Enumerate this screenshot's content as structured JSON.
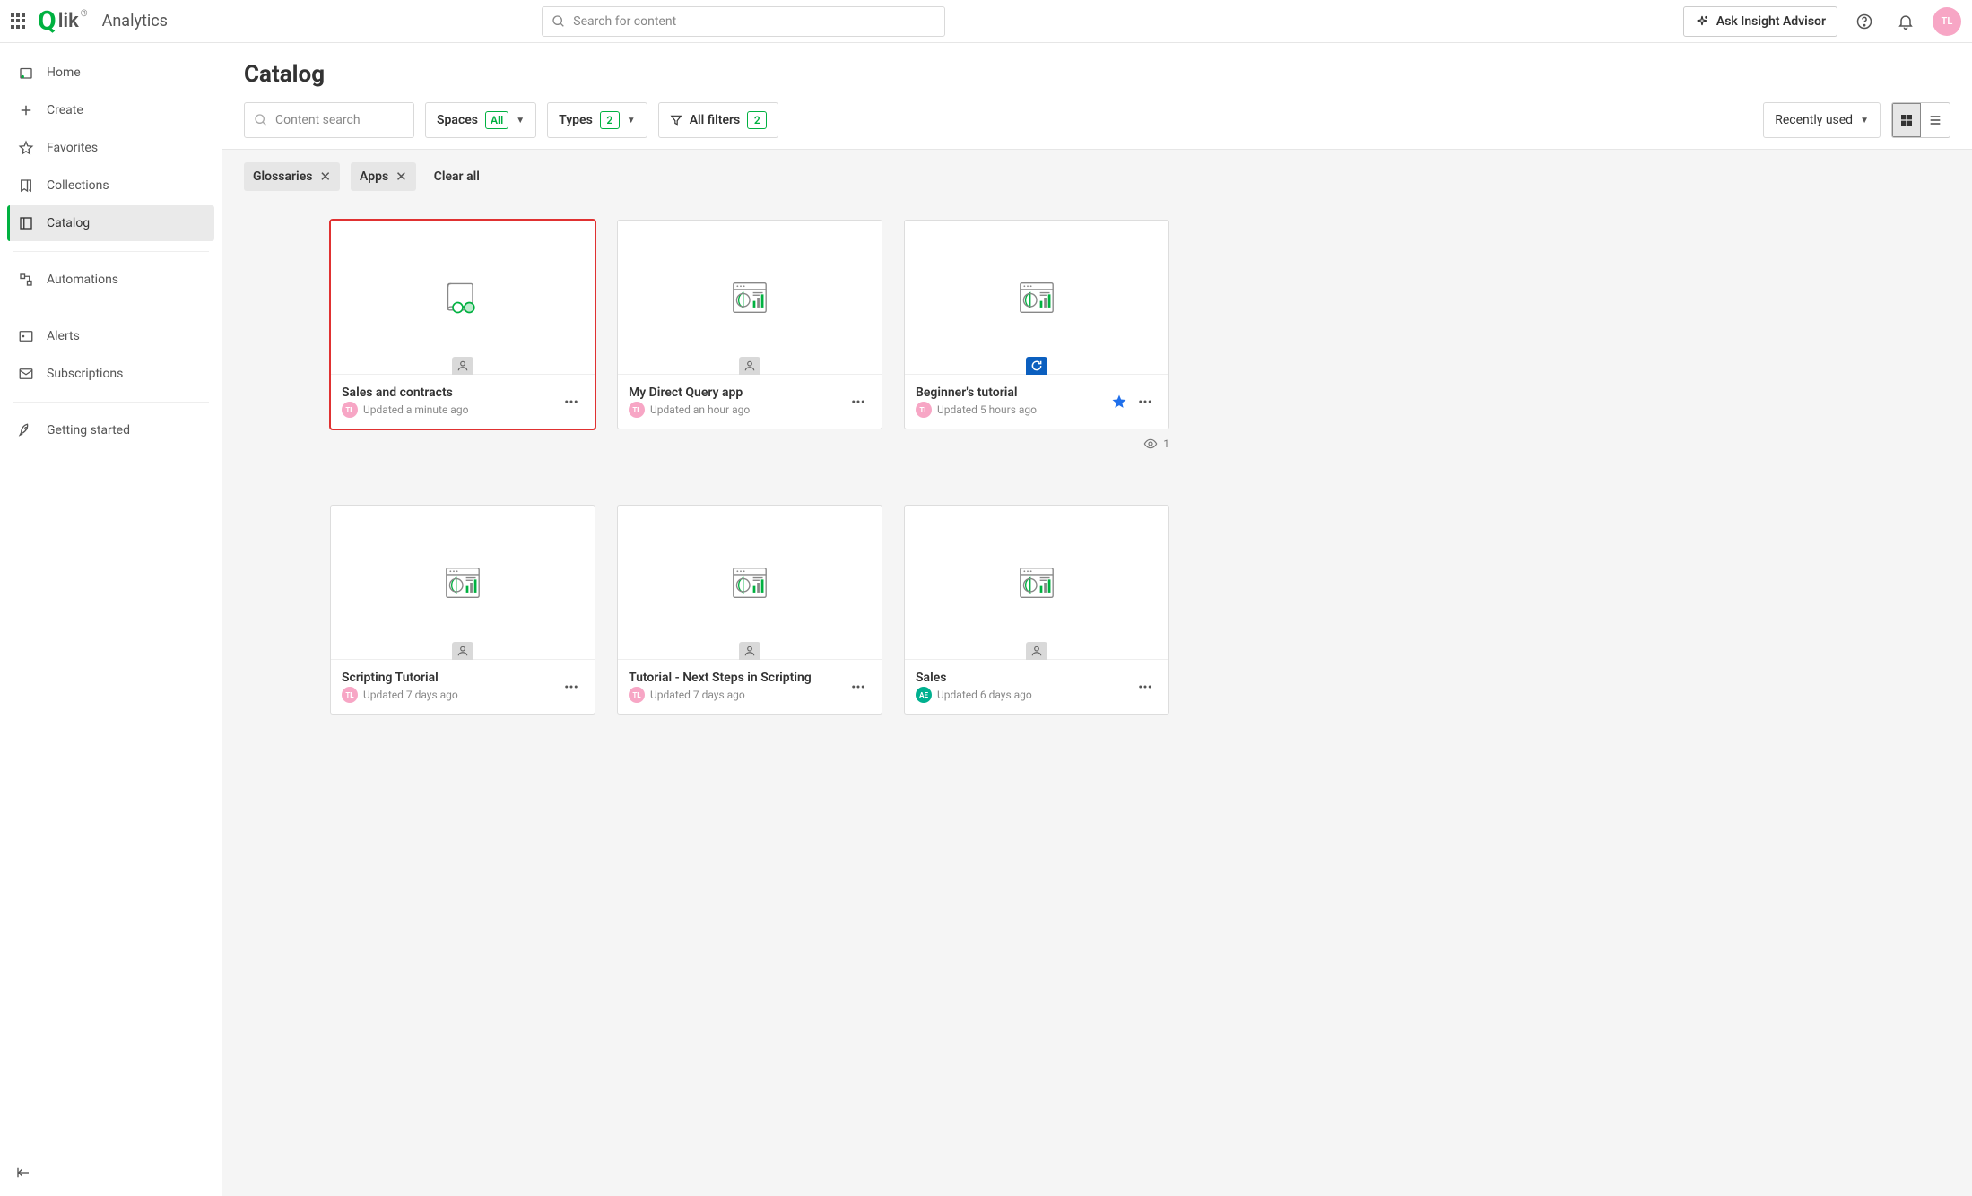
{
  "brand": {
    "logo_text": "lik",
    "section": "Analytics"
  },
  "topbar": {
    "search_placeholder": "Search for content",
    "ask_label": "Ask Insight Advisor",
    "avatar_initials": "TL"
  },
  "sidebar": {
    "home": "Home",
    "create": "Create",
    "favorites": "Favorites",
    "collections": "Collections",
    "catalog": "Catalog",
    "automations": "Automations",
    "alerts": "Alerts",
    "subscriptions": "Subscriptions",
    "getting_started": "Getting started"
  },
  "page": {
    "title": "Catalog"
  },
  "toolbar": {
    "content_search_placeholder": "Content search",
    "spaces_label": "Spaces",
    "spaces_badge": "All",
    "types_label": "Types",
    "types_badge": "2",
    "allfilters_label": "All filters",
    "allfilters_badge": "2",
    "sort_label": "Recently used"
  },
  "chips": {
    "glossaries": "Glossaries",
    "apps": "Apps",
    "clear_all": "Clear all"
  },
  "cards": [
    {
      "title": "Sales and contracts",
      "updated": "Updated a minute ago",
      "owner_initials": "TL",
      "owner_color": "pink",
      "thumb": "glossary",
      "highlight": true,
      "starred": false,
      "badge": "person",
      "view_count": null
    },
    {
      "title": "My Direct Query app",
      "updated": "Updated an hour ago",
      "owner_initials": "TL",
      "owner_color": "pink",
      "thumb": "app",
      "highlight": false,
      "starred": false,
      "badge": "person",
      "view_count": null
    },
    {
      "title": "Beginner's tutorial",
      "updated": "Updated 5 hours ago",
      "owner_initials": "TL",
      "owner_color": "pink",
      "thumb": "app",
      "highlight": false,
      "starred": true,
      "badge": "reload-blue",
      "view_count": "1"
    },
    {
      "title": "Scripting Tutorial",
      "updated": "Updated 7 days ago",
      "owner_initials": "TL",
      "owner_color": "pink",
      "thumb": "app",
      "highlight": false,
      "starred": false,
      "badge": "person",
      "view_count": null
    },
    {
      "title": "Tutorial - Next Steps in Scripting",
      "updated": "Updated 7 days ago",
      "owner_initials": "TL",
      "owner_color": "pink",
      "thumb": "app",
      "highlight": false,
      "starred": false,
      "badge": "person",
      "view_count": null
    },
    {
      "title": "Sales",
      "updated": "Updated 6 days ago",
      "owner_initials": "AE",
      "owner_color": "green",
      "thumb": "app",
      "highlight": false,
      "starred": false,
      "badge": "person",
      "view_count": null
    }
  ]
}
